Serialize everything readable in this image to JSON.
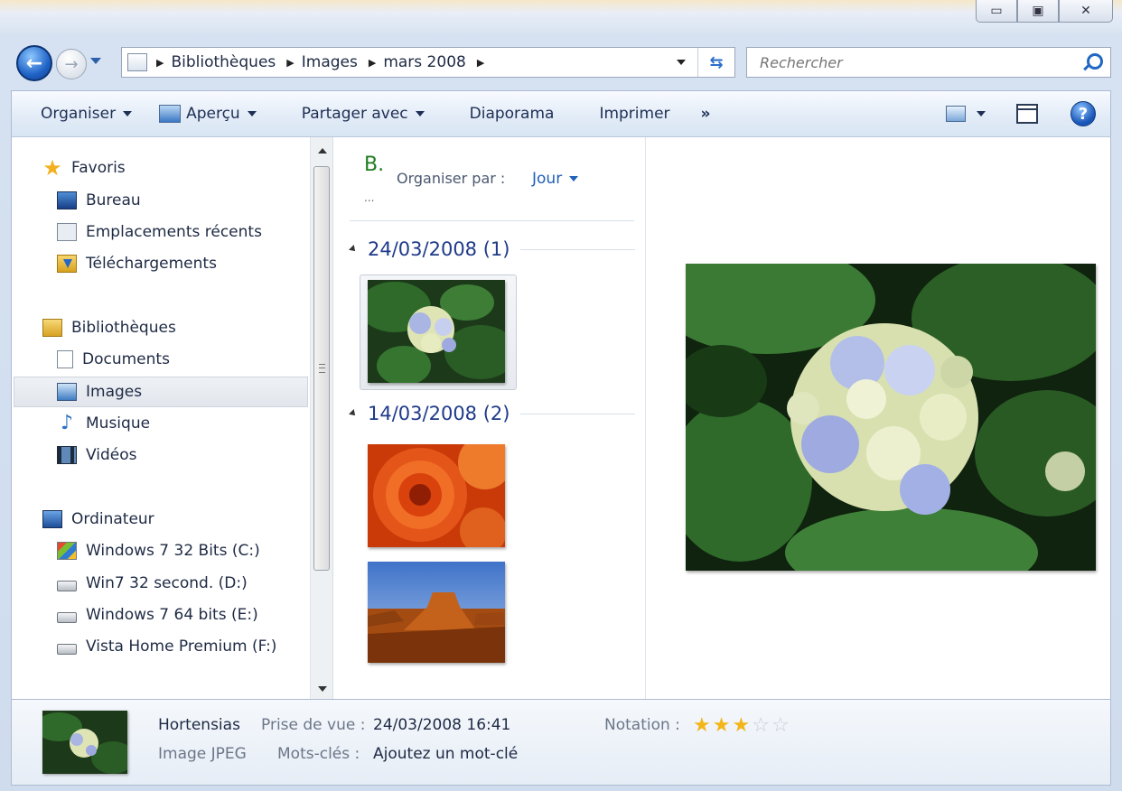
{
  "window": {
    "controls": [
      "minimize",
      "maximize",
      "close"
    ]
  },
  "address": {
    "crumbs": [
      "Bibliothèques",
      "Images",
      "mars 2008"
    ],
    "search_placeholder": "Rechercher"
  },
  "toolbar": {
    "organize": "Organiser",
    "preview": "Aperçu",
    "share": "Partager avec",
    "slideshow": "Diaporama",
    "print": "Imprimer",
    "more": "»"
  },
  "nav": {
    "favorites": "Favoris",
    "favorites_items": [
      "Bureau",
      "Emplacements récents",
      "Téléchargements"
    ],
    "libraries": "Bibliothèques",
    "libraries_items": [
      "Documents",
      "Images",
      "Musique",
      "Vidéos"
    ],
    "computer": "Ordinateur",
    "drives": [
      "Windows 7 32 Bits (C:)",
      "Win7 32 second. (D:)",
      "Windows 7 64 bits (E:)",
      "Vista Home Premium (F:)"
    ],
    "selected": "Images"
  },
  "files": {
    "library_title": "B.",
    "library_dots": "...",
    "arrange_label": "Organiser par :",
    "arrange_value": "Jour",
    "groups": [
      {
        "label": "24/03/2008 (1)"
      },
      {
        "label": "14/03/2008 (2)"
      }
    ]
  },
  "details": {
    "name": "Hortensias",
    "type": "Image JPEG",
    "date_label": "Prise de vue :",
    "date_value": "24/03/2008 16:41",
    "keywords_label": "Mots-clés :",
    "keywords_value": "Ajoutez un mot-clé",
    "rating_label": "Notation :",
    "rating": 3,
    "rating_max": 5
  },
  "colors": {
    "accent": "#2060b8",
    "group_header": "#1f3a8a",
    "library_title": "#1f7d1f",
    "star": "#f2b61a"
  }
}
